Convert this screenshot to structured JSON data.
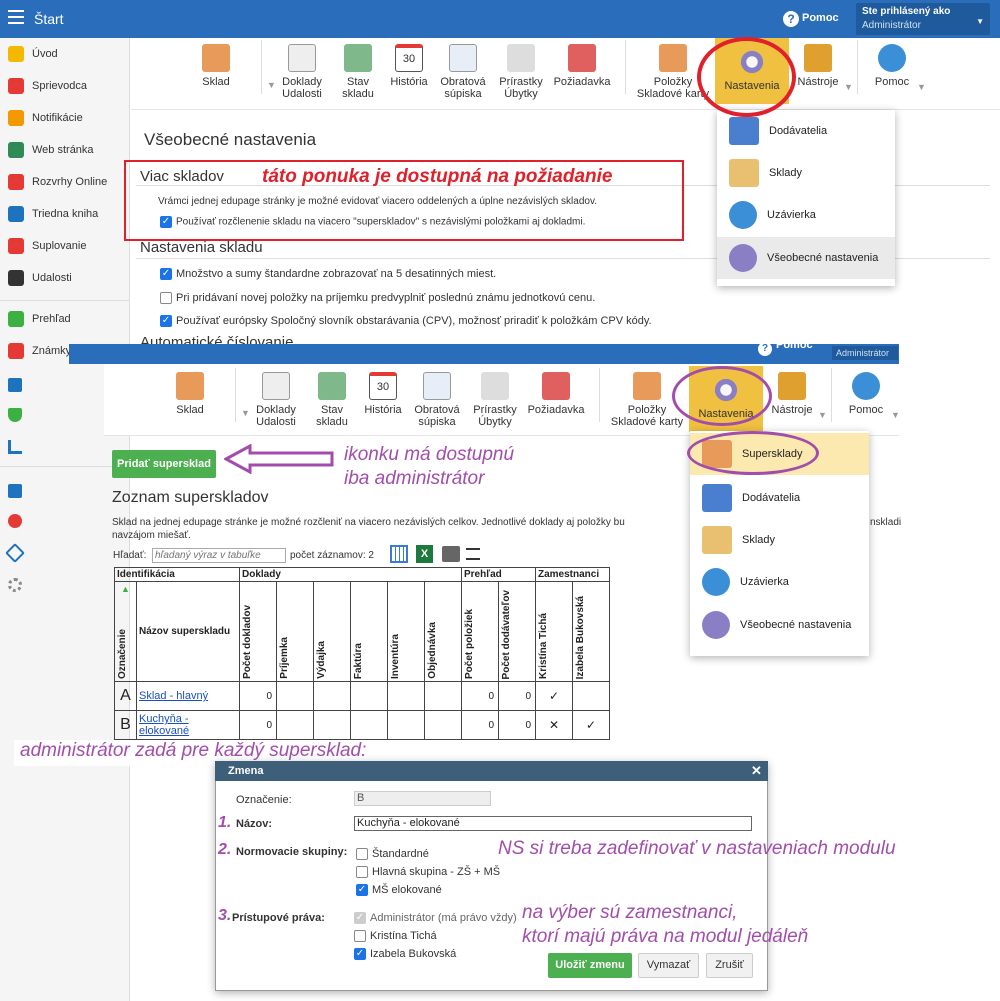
{
  "topbar": {
    "title": "Štart",
    "help": "Pomoc",
    "user_label": "Ste prihlásený ako",
    "user_role": "Administrátor"
  },
  "sidebar": {
    "items": [
      {
        "label": "Úvod",
        "color": "#f5b800"
      },
      {
        "label": "Sprievodca",
        "color": "#e53935"
      },
      {
        "label": "Notifikácie",
        "color": "#f29900"
      },
      {
        "label": "Web stránka",
        "color": "#2e8b57"
      },
      {
        "label": "Rozvrhy Online",
        "color": "#e53935"
      },
      {
        "label": "Triedna kniha",
        "color": "#1e73be"
      },
      {
        "label": "Suplovanie",
        "color": "#e53935"
      },
      {
        "label": "Udalosti",
        "color": "#333333"
      },
      {
        "label": "Prehľad",
        "color": "#3cb043"
      },
      {
        "label": "Známky",
        "color": "#e53935"
      }
    ]
  },
  "toolbar": {
    "sklad": "Sklad",
    "doklady": "Doklady Udalosti",
    "stav": "Stav skladu",
    "historia": "História",
    "hist_num": "30",
    "obratova": "Obratová súpiska",
    "prirastky": "Prírastky Úbytky",
    "poziadavka": "Požiadavka",
    "polozky": "Položky Skladové karty",
    "nastavenia": "Nastavenia",
    "nastroje": "Nástroje",
    "pomoc": "Pomoc"
  },
  "menu1": {
    "items": [
      "Dodávatelia",
      "Sklady",
      "Uzávierka",
      "Všeobecné nastavenia"
    ]
  },
  "settings": {
    "title": "Všeobecné nastavenia",
    "viac_skladov": "Viac skladov",
    "viac_desc": "Vrámci jednej edupage stránky je možné evidovať viacero oddelených a úplne nezávislých skladov.",
    "viac_opt": "Používať rozčlenenie skladu na viacero \"superskladov\" s nezávislými položkami aj dokladmi.",
    "nast_skladu": "Nastavenia skladu",
    "opt1": "Množstvo a sumy štandardne zobrazovať na 5 desatinných miest.",
    "opt2": "Pri pridávaní novej položky na príjemku predvyplniť poslednú známu jednotkovú cenu.",
    "opt3": "Používať európsky Spoločný slovník obstarávania (CPV), možnosť priradiť k položkám CPV kódy.",
    "auto": "Automatické číslovanie"
  },
  "annotations": {
    "a1": "táto ponuka je dostupná na požiadanie",
    "a2": "ikonku má dostupnú",
    "a3": "iba administrátor",
    "a4": "administrátor zadá pre každý supersklad:",
    "a5": "NS si treba zadefinovať v nastaveniach modulu",
    "a6": "na výber sú zamestnanci,",
    "a7": "ktorí majú práva na modul jedáleň"
  },
  "menu2": {
    "items": [
      "Supersklady",
      "Dodávatelia",
      "Sklady",
      "Uzávierka",
      "Všeobecné nastavenia"
    ]
  },
  "supersklady": {
    "add_button": "Pridať supersklad",
    "title": "Zoznam superskladov",
    "desc1": "Sklad na jednej edupage stránke je možné rozčleniť na viacero nezávislých celkov. Jednotlivé doklady aj položky bu",
    "desc1b": "nskladi",
    "desc2": "navzájom miešať.",
    "search_label": "Hľadať:",
    "search_placeholder": "hľadaný výraz v tabuľke",
    "count": "počet záznamov: 2",
    "groups": [
      "Identifikácia",
      "Doklady",
      "Prehľad",
      "Zamestnanci"
    ],
    "cols": [
      "Označenie",
      "Názov superskladu",
      "Počet dokladov",
      "Príjemka",
      "Výdajka",
      "Faktúra",
      "Inventúra",
      "Objednávka",
      "Počet položiek",
      "Počet dodávateľov",
      "Kristína Tichá",
      "Izabela Bukovská"
    ],
    "rows": [
      {
        "code": "A",
        "name": "Sklad - hlavný",
        "dok": "0",
        "pol": "0",
        "dod": "0",
        "k": "✓",
        "i": ""
      },
      {
        "code": "B",
        "name": "Kuchyňa - elokované",
        "dok": "0",
        "pol": "0",
        "dod": "0",
        "k": "✕",
        "i": "✓"
      }
    ]
  },
  "dialog": {
    "title": "Zmena",
    "oznacenie_label": "Označenie:",
    "oznacenie_val": "B",
    "nazov_num": "1.",
    "nazov_label": "Názov:",
    "nazov_val": "Kuchyňa - elokované",
    "norm_num": "2.",
    "norm_label": "Normovacie skupiny:",
    "norm_opts": [
      "Štandardné",
      "Hlavná skupina - ZŠ + MŠ",
      "MŠ elokované"
    ],
    "prist_num": "3.",
    "prist_label": "Prístupové práva:",
    "prist_opts": [
      "Administrátor (má právo vždy)",
      "Kristína Tichá",
      "Izabela Bukovská"
    ],
    "save": "Uložiť zmenu",
    "delete": "Vymazať",
    "cancel": "Zrušiť"
  }
}
